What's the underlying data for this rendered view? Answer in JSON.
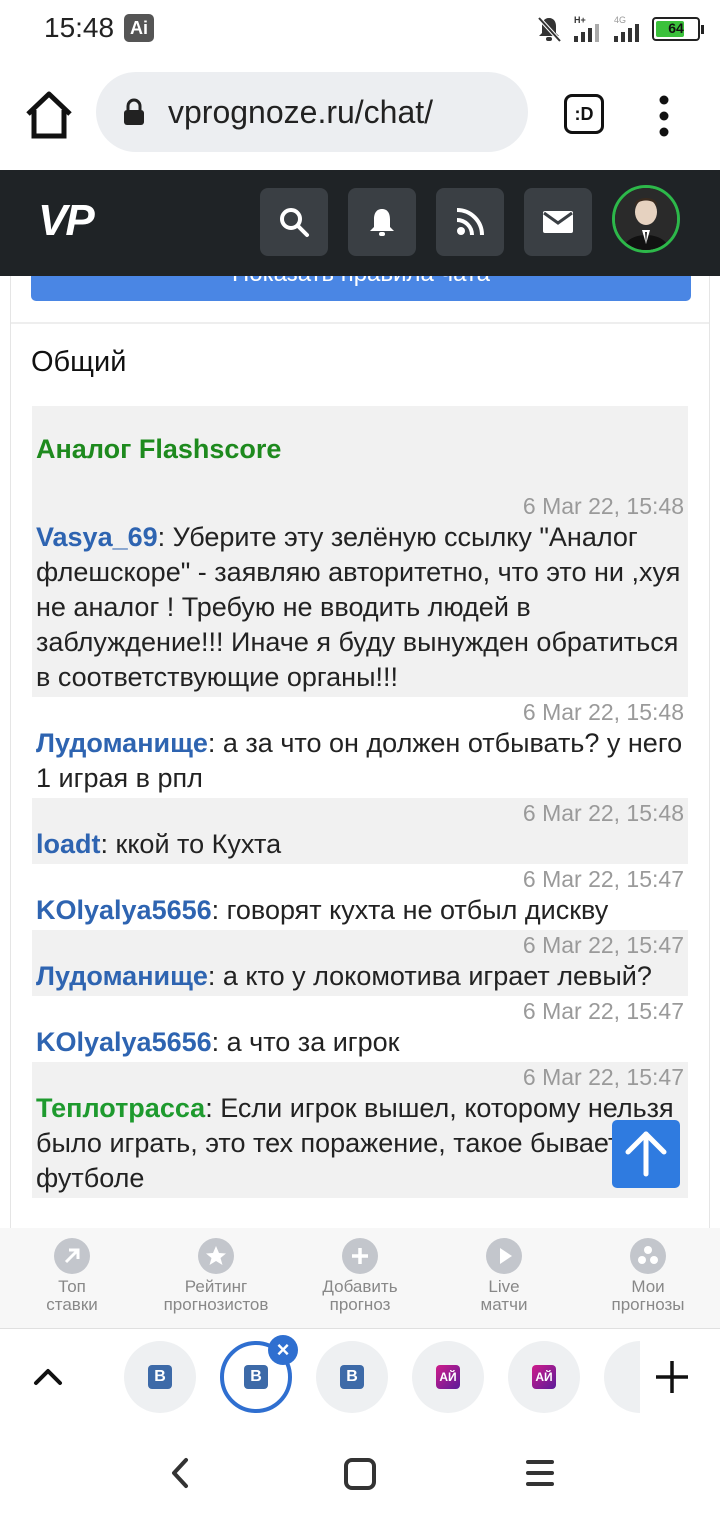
{
  "status_bar": {
    "time": "15:48",
    "ai_badge": "Ai",
    "battery": "64",
    "battery_level": 0.64
  },
  "browser": {
    "url": "vprognoze.ru/chat/",
    "tab_switcher_label": ":D"
  },
  "site": {
    "logo": "VP"
  },
  "main": {
    "rules_button": "Показать правила чата",
    "chat_title": "Общий",
    "pinned_link": "Аналог Flashscore",
    "messages": [
      {
        "time": "6 Mar 22, 15:48",
        "user": "Vasya_69",
        "text": ": Уберите эту зелёную ссылку \"Аналог флешскоре\" - заявляю авторитетно, что это ни ,хуя не аналог ! Требую не вводить людей в заблуждение!!! Иначе я буду вынужден обратиться в соответствующие органы!!!"
      },
      {
        "time": "6 Mar 22, 15:48",
        "user": "Лудоманище",
        "text": ": а за что он должен отбывать? у него 1 играя в рпл"
      },
      {
        "time": "6 Mar 22, 15:48",
        "user": "loadt",
        "text": ": ккой то Кухта"
      },
      {
        "time": "6 Mar 22, 15:47",
        "user": "KOlyalya5656",
        "text": ": говорят кухта не отбыл дискву"
      },
      {
        "time": "6 Mar 22, 15:47",
        "user": "Лудоманище",
        "text": ": а кто у локомотива играет левый?"
      },
      {
        "time": "6 Mar 22, 15:47",
        "user": "KOlyalya5656",
        "text": ": а что за игрок"
      },
      {
        "time": "6 Mar 22, 15:47",
        "user": "Теплотрасса",
        "text": ": Если игрок вышел, которому нельзя было играть, это тех поражение, такое бывает в футболе"
      }
    ]
  },
  "bottom_nav": [
    {
      "line1": "Топ",
      "line2": "ставки",
      "icon": "arrow-up-right-icon"
    },
    {
      "line1": "Рейтинг",
      "line2": "прогнозистов",
      "icon": "star-icon"
    },
    {
      "line1": "Добавить",
      "line2": "прогноз",
      "icon": "plus-icon"
    },
    {
      "line1": "Live",
      "line2": "матчи",
      "icon": "play-icon"
    },
    {
      "line1": "Мои",
      "line2": "прогнозы",
      "icon": "balls-icon"
    }
  ],
  "tab_strip": {
    "tabs": [
      {
        "favicon": "B"
      },
      {
        "favicon": "B"
      },
      {
        "favicon": "B"
      },
      {
        "favicon": "АЙ"
      },
      {
        "favicon": "АЙ"
      }
    ],
    "close_label": "×"
  }
}
